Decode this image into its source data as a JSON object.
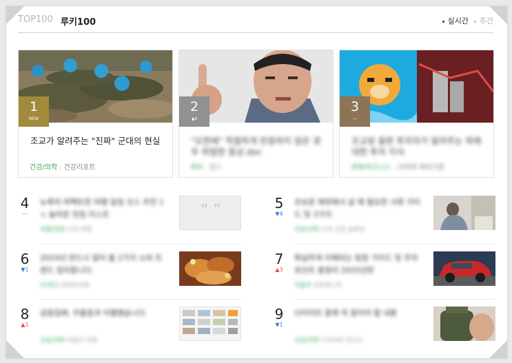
{
  "tabs": {
    "top100": "TOP100",
    "rookie": "루키100"
  },
  "sort": {
    "realtime": "실시간",
    "weekly": "주간"
  },
  "colors": {
    "rank_gold": "#a18a3c",
    "rank_gray": "#8f9193",
    "rank_brown": "#8d7456",
    "category_green": "#3ba55c",
    "up_red": "#e24b4b",
    "down_blue": "#3d7ad9"
  },
  "featured": [
    {
      "rank": "1",
      "badge": "NEW",
      "title": "조교가 알려주는 \"진짜\" 군대의 현실",
      "category": "건강/의학",
      "author": "건강리포트",
      "image": "soldiers-photo"
    },
    {
      "rank": "2",
      "badge": "▲4",
      "title": "\"오한에\" 적절하게 반응하지 않은 경우 위험한 증상.doc",
      "category": "육아",
      "author": "맘스",
      "image": "man-pointing-photo"
    },
    {
      "rank": "3",
      "badge": "—",
      "title": "조교장 출판 투자자가 알려주는 위에 대한 투자 지식",
      "category": "경제/비즈니스",
      "author": "이태재 재테크랩",
      "image": "cartoon-and-coins-photo"
    }
  ],
  "list_left": [
    {
      "rank": "4",
      "change": "—",
      "change_dir": "flat",
      "title": "뉴욕의 퍼펙트한 여행 일정 코스 추천 1 + 놀라운 맛집 리스트",
      "category": "여행/맛집",
      "author": "나의 여행",
      "image": "quote-placeholder"
    },
    {
      "rank": "6",
      "change": "▼1",
      "change_dir": "down",
      "title": "2024년 반드시 알아 둘 2가지 소비 트렌드 정리합니다.",
      "category": "IT/테크",
      "author": "경제브리핑",
      "image": "fried-food-photo"
    },
    {
      "rank": "8",
      "change": "▲1",
      "change_dir": "up",
      "title": "공동집배, 우울증과 이별했습니다.",
      "category": "건강/의학",
      "author": "마음의 치유",
      "image": "web-page-screenshot"
    }
  ],
  "list_right": [
    {
      "rank": "5",
      "change": "▼4",
      "change_dir": "down",
      "title": "초보운 해외에서 살 때 필요한 서류 가이드 및 3가지",
      "category": "건강/의학",
      "author": "나의 건강 솔루션",
      "image": "person-sitting-photo"
    },
    {
      "rank": "7",
      "change": "▲3",
      "change_dir": "up",
      "title": "확실하게 이해되는 팀장 가이드 및 주의 포인트 총정리 2025년판",
      "category": "자동차",
      "author": "오토매니아",
      "image": "red-car-photo"
    },
    {
      "rank": "9",
      "change": "▼1",
      "change_dir": "down",
      "title": "다이어트 중에 꼭 알아야 할 내용",
      "category": "건강/의학",
      "author": "다이어트 연구소",
      "image": "bottle-photo"
    }
  ]
}
